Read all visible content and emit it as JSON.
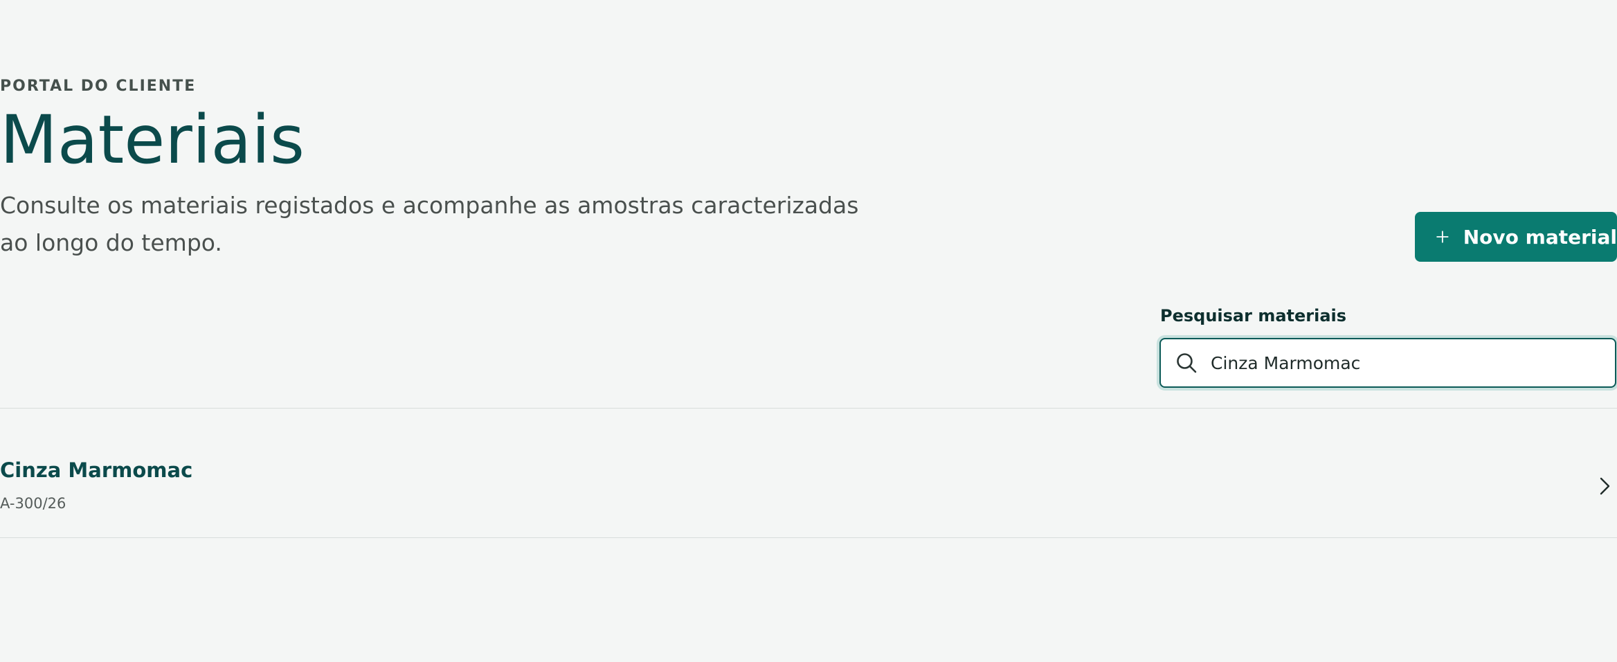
{
  "header": {
    "eyebrow": "PORTAL DO CLIENTE",
    "title": "Materiais",
    "description": "Consulte os materiais registados e acompanhe as amostras caracterizadas ao longo do tempo."
  },
  "actions": {
    "new_material_label": "Novo material",
    "new_material_icon": "plus-icon"
  },
  "search": {
    "label": "Pesquisar materiais",
    "value": "Cinza Marmomac",
    "icon": "search-icon"
  },
  "materials": [
    {
      "name": "Cinza Marmomac",
      "code": "A-300/26",
      "icon": "chevron-right-icon"
    }
  ],
  "colors": {
    "background": "#f4f6f5",
    "title": "#0b4a4b",
    "accent_button": "#0a7b70",
    "search_border": "#0b5a57",
    "divider": "#d8dddb"
  }
}
